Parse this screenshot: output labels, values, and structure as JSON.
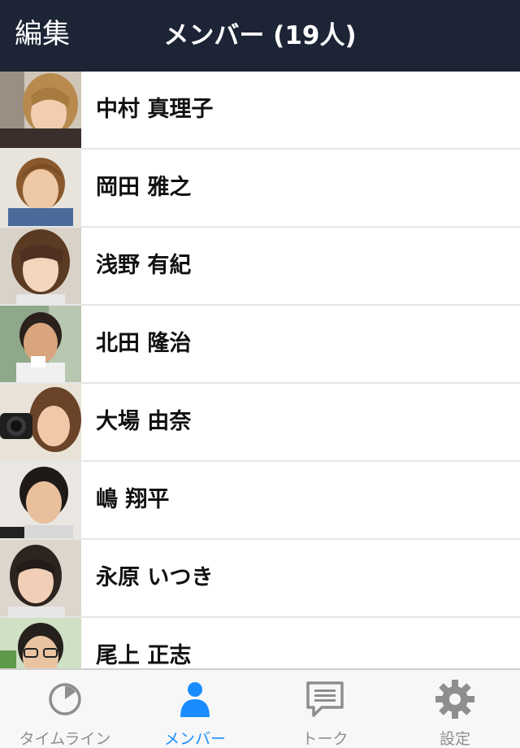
{
  "navbar": {
    "edit_label": "編集",
    "title": "メンバー (19人)"
  },
  "members": [
    {
      "name": "中村 真理子"
    },
    {
      "name": "岡田 雅之"
    },
    {
      "name": "浅野 有紀"
    },
    {
      "name": "北田 隆治"
    },
    {
      "name": "大場 由奈"
    },
    {
      "name": "嶋 翔平"
    },
    {
      "name": "永原 いつき"
    },
    {
      "name": "尾上 正志"
    }
  ],
  "tabbar": {
    "tabs": [
      {
        "label": "タイムライン",
        "icon": "timeline-clock-icon",
        "active": false
      },
      {
        "label": "メンバー",
        "icon": "member-person-icon",
        "active": true
      },
      {
        "label": "トーク",
        "icon": "talk-speech-bubble-icon",
        "active": false
      },
      {
        "label": "設定",
        "icon": "settings-gear-icon",
        "active": false
      }
    ]
  },
  "colors": {
    "navbar_bg": "#1c2435",
    "active_tab": "#1a8cff",
    "inactive_tab": "#8e8e8e"
  }
}
